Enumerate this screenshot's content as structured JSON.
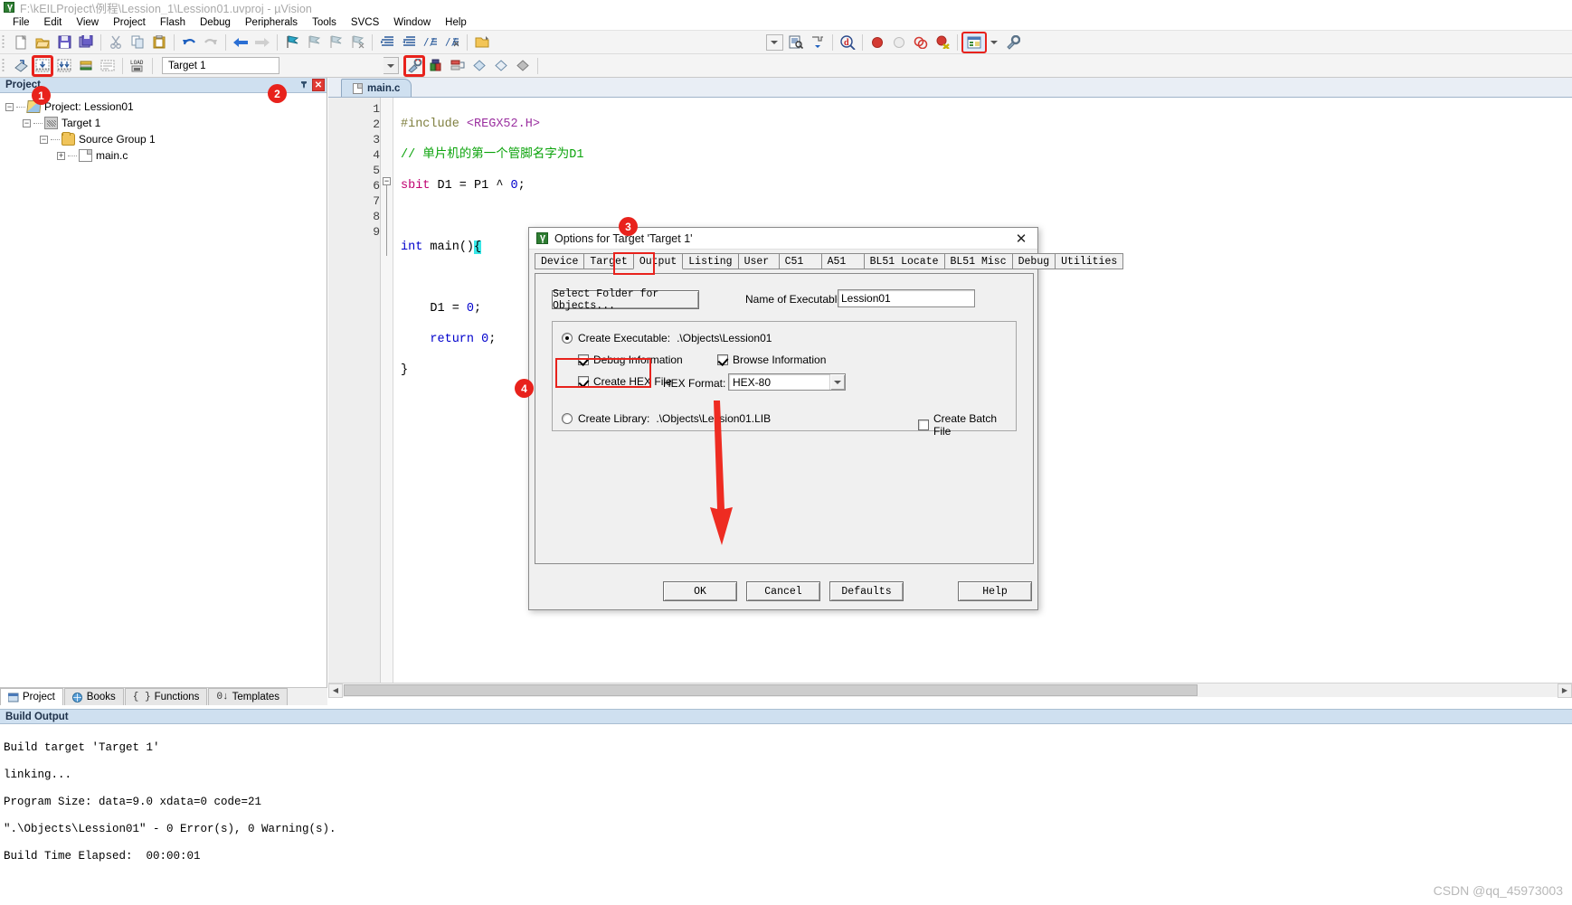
{
  "window": {
    "title": "F:\\kEILProject\\例程\\Lession_1\\Lession01.uvproj - µVision",
    "app_icon": "uvision-icon"
  },
  "menubar": {
    "items": [
      "File",
      "Edit",
      "View",
      "Project",
      "Flash",
      "Debug",
      "Peripherals",
      "Tools",
      "SVCS",
      "Window",
      "Help"
    ]
  },
  "toolbar_row1": {
    "icons": [
      "new-file-icon",
      "open-file-icon",
      "save-icon",
      "save-all-icon",
      "cut-icon",
      "copy-icon",
      "paste-icon",
      "undo-icon",
      "redo-icon",
      "back-icon",
      "forward-icon",
      "bookmark-toggle-icon",
      "bookmark-prev-icon",
      "bookmark-next-icon",
      "bookmark-clear-icon",
      "indent-icon",
      "outdent-icon",
      "comment-icon",
      "uncomment-icon",
      "open-folder-icon",
      "find-in-files-icon",
      "configure-icon",
      "debug-session-icon",
      "breakpoint-icon",
      "breakpoint-disable-icon",
      "breakpoint-all-icon",
      "breakpoint-kill-icon",
      "window-layout-icon",
      "layout-caret-icon",
      "configuration-wizard-icon"
    ]
  },
  "toolbar_row2": {
    "icons": [
      "translate-icon",
      "build-icon",
      "rebuild-icon",
      "batch-build-icon",
      "stop-build-icon",
      "load-icon",
      "manage-project-icon",
      "manage-components-icon",
      "multi-project-icon",
      "prev-target-icon",
      "next-target-icon",
      "target-icon"
    ],
    "target_combo_value": "Target 1"
  },
  "project_panel": {
    "header_title": "Project",
    "pin_icon": "pin-icon",
    "close_icon": "close-icon",
    "tree": [
      {
        "label": "Project: Lession01",
        "icon": "project-icon",
        "expander": "-",
        "depth": 0
      },
      {
        "label": "Target 1",
        "icon": "target-icon",
        "expander": "-",
        "depth": 1
      },
      {
        "label": "Source Group 1",
        "icon": "folder-icon",
        "expander": "-",
        "depth": 2
      },
      {
        "label": "main.c",
        "icon": "c-file-icon",
        "expander": "+",
        "depth": 3
      }
    ],
    "bottom_tabs": [
      {
        "label": "Project",
        "icon": "project-tab-icon",
        "active": true
      },
      {
        "label": "Books",
        "icon": "books-tab-icon",
        "active": false
      },
      {
        "label": "Functions",
        "icon": "functions-tab-icon",
        "active": false
      },
      {
        "label": "Templates",
        "icon": "templates-tab-icon",
        "active": false
      }
    ]
  },
  "editor": {
    "tab_label": "main.c",
    "tab_icon": "c-file-icon",
    "line_numbers": [
      "1",
      "2",
      "3",
      "4",
      "5",
      "6",
      "7",
      "8",
      "9"
    ],
    "lines": [
      "#include <REGX52.H>",
      "// 单片机的第一个管脚名字为D1",
      "sbit D1 = P1 ^ 0;",
      "",
      "int main(){",
      "",
      "    D1 = 0;",
      "    return 0;",
      "}"
    ]
  },
  "build_output": {
    "header_title": "Build Output",
    "lines": [
      "Build target 'Target 1'",
      "linking...",
      "Program Size: data=9.0 xdata=0 code=21",
      "\".\\Objects\\Lession01\" - 0 Error(s), 0 Warning(s).",
      "Build Time Elapsed:  00:00:01"
    ]
  },
  "watermark": "CSDN @qq_45973003",
  "dialog": {
    "title": "Options for Target 'Target 1'",
    "icon": "uvision-icon",
    "close_icon": "close-icon",
    "tabs": [
      {
        "label": "Device",
        "active": false
      },
      {
        "label": "Target",
        "active": false
      },
      {
        "label": "Output",
        "active": true
      },
      {
        "label": "Listing",
        "active": false
      },
      {
        "label": "User",
        "active": false
      },
      {
        "label": "C51",
        "active": false
      },
      {
        "label": "A51",
        "active": false
      },
      {
        "label": "BL51 Locate",
        "active": false
      },
      {
        "label": "BL51 Misc",
        "active": false
      },
      {
        "label": "Debug",
        "active": false
      },
      {
        "label": "Utilities",
        "active": false
      }
    ],
    "select_folder_button": "Select Folder for Objects...",
    "name_of_executable_label": "Name of Executable:",
    "name_of_executable_value": "Lession01",
    "create_executable": {
      "label": "Create Executable:",
      "path": ".\\Objects\\Lession01",
      "selected": true
    },
    "debug_information": {
      "label": "Debug Information",
      "checked": true
    },
    "browse_information": {
      "label": "Browse Information",
      "checked": true
    },
    "create_hex_file": {
      "label": "Create HEX File",
      "checked": true
    },
    "hex_format_label": "HEX Format:",
    "hex_format_value": "HEX-80",
    "create_library": {
      "label": "Create Library:",
      "path": ".\\Objects\\Lession01.LIB",
      "selected": false
    },
    "create_batch_file": {
      "label": "Create Batch File",
      "checked": false
    },
    "buttons": [
      "OK",
      "Cancel",
      "Defaults",
      "Help"
    ]
  },
  "callouts": [
    {
      "number": "1"
    },
    {
      "number": "2"
    },
    {
      "number": "3"
    },
    {
      "number": "4"
    }
  ],
  "colors": {
    "accent_red": "#e8221c",
    "panel_header": "#cfe0f0",
    "dialog_bg": "#f0f0f0"
  }
}
